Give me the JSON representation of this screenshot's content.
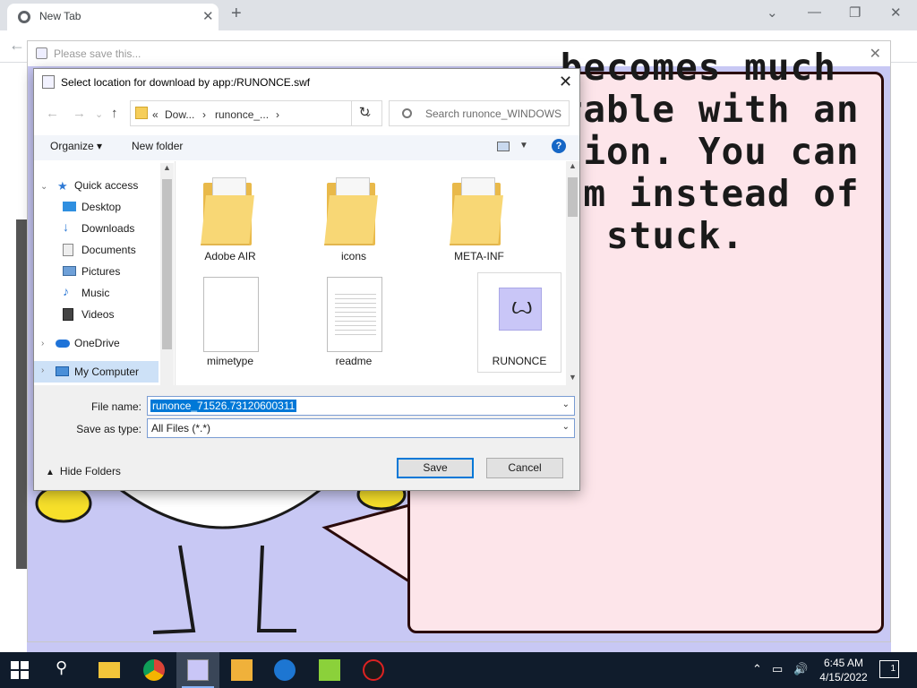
{
  "browser": {
    "tab_title": "New Tab",
    "tab_close_glyph": "✕",
    "new_tab_glyph": "+",
    "window_controls": [
      "⌄",
      "—",
      "❐",
      "✕"
    ]
  },
  "app_window": {
    "title": "Please save this...",
    "close_glyph": "✕"
  },
  "flash_content": {
    "bubble_lines": [
      " becomes much",
      "arable with an",
      "ation. You can",
      "eam instead of",
      "ng stuck."
    ],
    "bubble_color": "#fde5ea",
    "stage_color": "#c8c8f4"
  },
  "dialog": {
    "title": "Select location for download by app:/RUNONCE.swf",
    "close_glyph": "✕",
    "address": {
      "prefix": "«",
      "segments": [
        "Dow...",
        "runonce_...",
        ""
      ],
      "separator": "›"
    },
    "search_placeholder": "Search runonce_WINDOWS",
    "toolbar": {
      "organize": "Organize ▾",
      "new_folder": "New folder",
      "help_glyph": "?"
    },
    "nav": {
      "quick_access": "Quick access",
      "items": [
        {
          "label": "Desktop",
          "icon": "desktop-icon",
          "pinned": true
        },
        {
          "label": "Downloads",
          "icon": "downloads-icon",
          "pinned": true
        },
        {
          "label": "Documents",
          "icon": "documents-icon",
          "pinned": true
        },
        {
          "label": "Pictures",
          "icon": "pictures-icon",
          "pinned": true
        },
        {
          "label": "Music",
          "icon": "music-icon",
          "pinned": false
        },
        {
          "label": "Videos",
          "icon": "videos-icon",
          "pinned": false
        }
      ],
      "onedrive": "OneDrive",
      "my_computer": "My Computer"
    },
    "files": [
      {
        "name": "Adobe AIR",
        "type": "folder"
      },
      {
        "name": "icons",
        "type": "folder"
      },
      {
        "name": "META-INF",
        "type": "folder"
      },
      {
        "name": "mimetype",
        "type": "file"
      },
      {
        "name": "readme",
        "type": "text"
      },
      {
        "name": "RUNONCE",
        "type": "swf"
      }
    ],
    "file_name_label": "File name:",
    "file_name_value": "runonce_71526.73120600311",
    "save_type_label": "Save as type:",
    "save_type_value": "All Files (*.*)",
    "hide_folders": "Hide Folders",
    "save_button": "Save",
    "cancel_button": "Cancel"
  },
  "taskbar": {
    "clock_time": "6:45 AM",
    "clock_date": "4/15/2022",
    "notification_count": "1"
  }
}
